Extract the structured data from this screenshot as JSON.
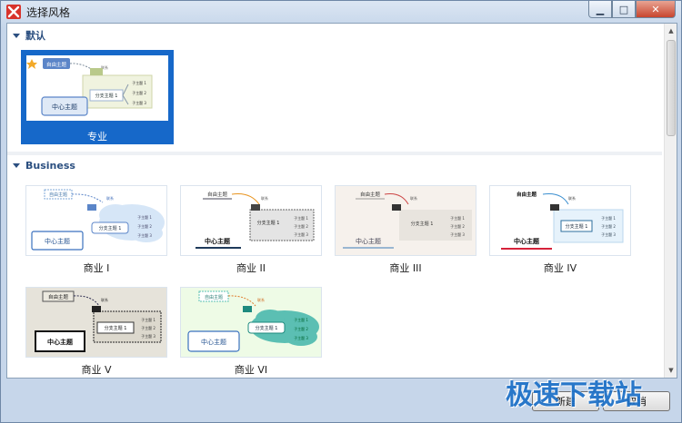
{
  "window": {
    "title": "选择风格"
  },
  "sections": {
    "default": {
      "label": "默认"
    },
    "business": {
      "label": "Business"
    }
  },
  "styles": {
    "pro": {
      "label": "专业",
      "central": "中心主题",
      "free": "自由主题",
      "main": "分支主题 1",
      "subs": [
        "子主题 1",
        "子主题 2",
        "子主题 3"
      ],
      "link": "联系"
    },
    "biz1": {
      "label": "商业 I",
      "central": "中心主题",
      "free": "自由主题",
      "main": "分支主题 1",
      "subs": [
        "子主题 1",
        "子主题 2",
        "子主题 3"
      ],
      "link": "联系"
    },
    "biz2": {
      "label": "商业 II",
      "central": "中心主题",
      "free": "自由主题",
      "main": "分支主题 1",
      "subs": [
        "子主题 1",
        "子主题 2",
        "子主题 3"
      ],
      "link": "联系"
    },
    "biz3": {
      "label": "商业 III",
      "central": "中心主题",
      "free": "自由主题",
      "main": "分支主题 1",
      "subs": [
        "子主题 1",
        "子主题 2",
        "子主题 3"
      ],
      "link": "联系"
    },
    "biz4": {
      "label": "商业 IV",
      "central": "中心主题",
      "free": "自由主题",
      "main": "分支主题 1",
      "subs": [
        "子主题 1",
        "子主题 2",
        "子主题 3"
      ],
      "link": "联系"
    },
    "biz5": {
      "label": "商业 V",
      "central": "中心主题",
      "free": "自由主题",
      "main": "分支主题 1",
      "subs": [
        "子主题 1",
        "子主题 2",
        "子主题 3"
      ],
      "link": "联系"
    },
    "biz6": {
      "label": "商业 VI",
      "central": "中心主题",
      "free": "自由主题",
      "main": "分支主题 1",
      "subs": [
        "子主题 1",
        "子主题 2",
        "子主题 3"
      ],
      "link": "联系"
    }
  },
  "footer": {
    "create_label": "新建",
    "cancel_label": "取消"
  },
  "watermark": "极速下载站",
  "colors": {
    "accent": "#1668c9",
    "title_bar": "#c6d6ea",
    "section_text": "#2b4f80"
  },
  "icons": {
    "app": "xmind-icon",
    "minimize": "minimize-icon",
    "maximize": "maximize-icon",
    "close": "close-icon",
    "star": "star-icon"
  }
}
